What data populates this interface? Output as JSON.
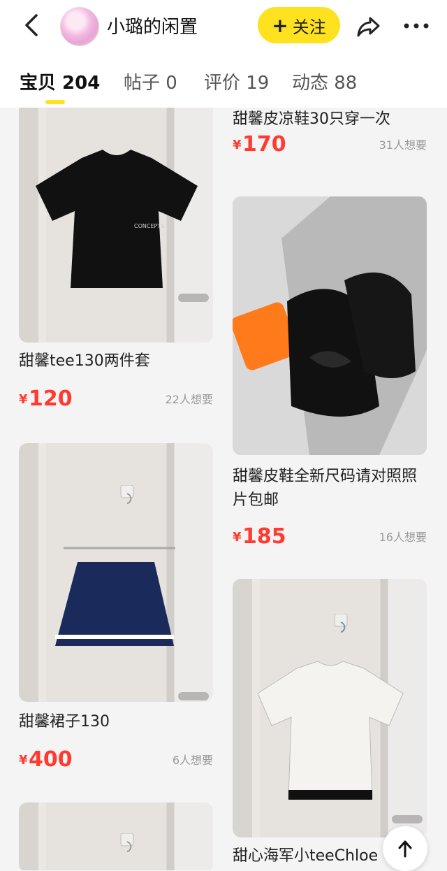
{
  "header": {
    "shop_name": "小璐的闲置",
    "follow_label": "关注",
    "follow_plus": "+"
  },
  "tabs": [
    {
      "label": "宝贝 204",
      "active": true
    },
    {
      "label": "帖子 0",
      "active": false
    },
    {
      "label": "评价 19",
      "active": false
    },
    {
      "label": "动态 88",
      "active": false
    }
  ],
  "products": {
    "left": [
      {
        "title": "甜馨tee130两件套",
        "yen": "¥",
        "price": "120",
        "want": "22人想要"
      },
      {
        "title": "甜馨裙子130",
        "yen": "¥",
        "price": "400",
        "want": "6人想要"
      }
    ],
    "right": [
      {
        "title": "甜馨皮凉鞋30只穿一次",
        "yen": "¥",
        "price": "170",
        "want": "31人想要"
      },
      {
        "title": "甜馨皮鞋全新尺码请对照照片包邮",
        "yen": "¥",
        "price": "185",
        "want": "16人想要"
      },
      {
        "title": "甜心海军小teeChloe"
      }
    ]
  },
  "colors": {
    "accent_yellow": "#ffe21f",
    "price_red": "#ff3b30",
    "muted_gray": "#9a9a9a"
  },
  "icons": {
    "back": "chevron-left-icon",
    "share": "share-arrow-icon",
    "more": "more-dots-icon",
    "scroll_top": "arrow-up-icon"
  }
}
